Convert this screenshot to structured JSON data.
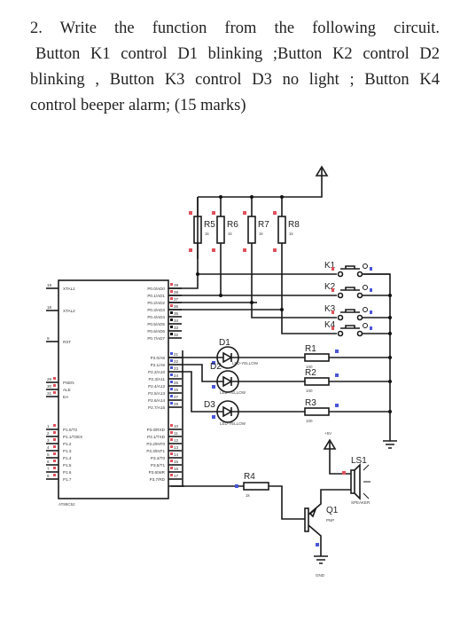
{
  "question": {
    "lines": [
      "2.   Write   the function from the   following   circuit.",
      "Button K1 control D1 blinking ;Button K2 control D2",
      "blinking , Button K3 control D3 no light ; Button K4",
      "control beeper alarm; (15 marks)"
    ]
  },
  "circuit": {
    "mcu": {
      "name": "AT89C52",
      "left_pins": [
        {
          "num": "19",
          "label": "XTAL1"
        },
        {
          "num": "18",
          "label": "XTAL2"
        },
        {
          "num": "9",
          "label": "RST"
        },
        {
          "num": "29",
          "label": "PSEN"
        },
        {
          "num": "30",
          "label": "ALE"
        },
        {
          "num": "31",
          "label": "EA"
        },
        {
          "num": "1",
          "label": "P1.0/T2"
        },
        {
          "num": "2",
          "label": "P1.1/T2EX"
        },
        {
          "num": "3",
          "label": "P1.2"
        },
        {
          "num": "4",
          "label": "P1.3"
        },
        {
          "num": "5",
          "label": "P1.4"
        },
        {
          "num": "6",
          "label": "P1.5"
        },
        {
          "num": "7",
          "label": "P1.6"
        },
        {
          "num": "8",
          "label": "P1.7"
        }
      ],
      "port0": [
        {
          "num": "39",
          "label": "P0.0/AD0"
        },
        {
          "num": "38",
          "label": "P0.1/AD1"
        },
        {
          "num": "37",
          "label": "P0.2/AD2"
        },
        {
          "num": "36",
          "label": "P0.3/AD3"
        },
        {
          "num": "35",
          "label": "P0.4/AD4"
        },
        {
          "num": "34",
          "label": "P0.5/AD5"
        },
        {
          "num": "33",
          "label": "P0.6/AD6"
        },
        {
          "num": "32",
          "label": "P0.7/AD7"
        }
      ],
      "port2": [
        {
          "num": "21",
          "label": "P2.0/A8"
        },
        {
          "num": "22",
          "label": "P2.1/A9"
        },
        {
          "num": "23",
          "label": "P2.2/A10"
        },
        {
          "num": "24",
          "label": "P2.3/A11"
        },
        {
          "num": "25",
          "label": "P2.4/A12"
        },
        {
          "num": "26",
          "label": "P2.5/A13"
        },
        {
          "num": "27",
          "label": "P2.6/A14"
        },
        {
          "num": "28",
          "label": "P2.7/A15"
        }
      ],
      "port3": [
        {
          "num": "10",
          "label": "P3.0/RXD"
        },
        {
          "num": "11",
          "label": "P3.1/TXD"
        },
        {
          "num": "12",
          "label": "P3.2/INT0"
        },
        {
          "num": "13",
          "label": "P3.3/INT1"
        },
        {
          "num": "14",
          "label": "P3.4/T0"
        },
        {
          "num": "15",
          "label": "P3.5/T1"
        },
        {
          "num": "16",
          "label": "P3.6/WR"
        },
        {
          "num": "17",
          "label": "P3.7/RD"
        }
      ]
    },
    "pullups": [
      {
        "name": "R5",
        "value": "1k"
      },
      {
        "name": "R6",
        "value": "1k"
      },
      {
        "name": "R7",
        "value": "1k"
      },
      {
        "name": "R8",
        "value": "1k"
      }
    ],
    "buttons": [
      {
        "name": "K1"
      },
      {
        "name": "K2"
      },
      {
        "name": "K3"
      },
      {
        "name": "K4"
      }
    ],
    "leds": [
      {
        "name": "D1",
        "type": "LED-YELLOW"
      },
      {
        "name": "D2",
        "type": "LED-YELLOW"
      },
      {
        "name": "D3",
        "type": "LED-YELLOW"
      }
    ],
    "led_resistors": [
      {
        "name": "R1",
        "value": "100"
      },
      {
        "name": "R2",
        "value": "100"
      },
      {
        "name": "R3",
        "value": "100"
      }
    ],
    "r4": {
      "name": "R4",
      "value": "1k"
    },
    "transistor": {
      "name": "Q1",
      "type": "PNP"
    },
    "speaker": {
      "name": "LS1",
      "type": "SPEAKER"
    },
    "supply_label": "+5V",
    "gnd_label": "GND",
    "colors": {
      "pin_red": "#e0505a",
      "pin_blue": "#4a55d8",
      "wire": "#1a1a1a"
    }
  }
}
